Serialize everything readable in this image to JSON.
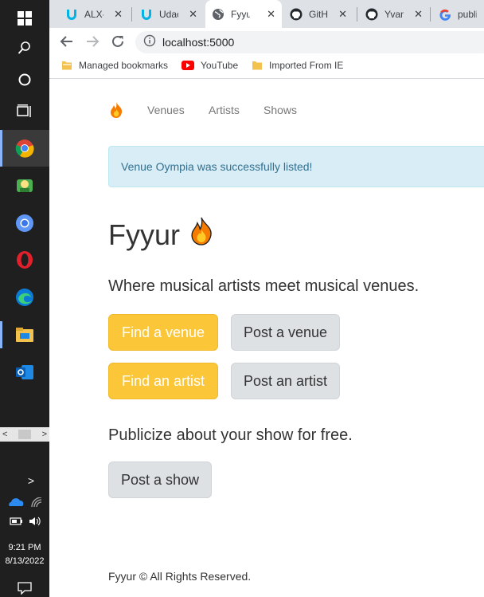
{
  "taskbar": {
    "items": [
      "windows-icon",
      "search-icon",
      "cortana-icon",
      "task-view-icon",
      "chrome-icon",
      "app-icon",
      "chrome-canary-icon",
      "opera-icon",
      "edge-icon",
      "file-explorer-icon",
      "outlook-icon"
    ],
    "scroll_left": "<",
    "scroll_right": ">",
    "tray_chevron": ">",
    "time": "9:21 PM",
    "date": "8/13/2022"
  },
  "browser": {
    "tabs": [
      {
        "label": "ALX-T",
        "icon": "udacity-icon"
      },
      {
        "label": "Udaci",
        "icon": "udacity-icon"
      },
      {
        "label": "Fyyur",
        "icon": "globe-icon",
        "active": true
      },
      {
        "label": "GitHu",
        "icon": "github-icon"
      },
      {
        "label": "YvanT",
        "icon": "github-icon"
      },
      {
        "label": "publi",
        "icon": "google-icon"
      }
    ],
    "close_glyph": "✕",
    "url": "localhost:5000",
    "bookmarks": [
      {
        "label": "Managed bookmarks",
        "icon": "folder-icon"
      },
      {
        "label": "YouTube",
        "icon": "youtube-icon"
      },
      {
        "label": "Imported From IE",
        "icon": "folder-icon"
      }
    ]
  },
  "site": {
    "nav": {
      "venues": "Venues",
      "artists": "Artists",
      "shows": "Shows"
    },
    "flash": "Venue Oympia was successfully listed!",
    "title": "Fyyur",
    "tagline": "Where musical artists meet musical venues.",
    "buttons": {
      "find_venue": "Find a venue",
      "post_venue": "Post a venue",
      "find_artist": "Find an artist",
      "post_artist": "Post an artist",
      "post_show": "Post a show"
    },
    "publicize": "Publicize about your show for free.",
    "footer": "Fyyur © All Rights Reserved."
  },
  "colors": {
    "taskbar": "#1f1f1f",
    "tabstrip": "#dee1e6",
    "alert_bg": "#d9edf7",
    "alert_text": "#31708f",
    "warning": "#fbc638",
    "default_btn": "#dde1e4"
  }
}
